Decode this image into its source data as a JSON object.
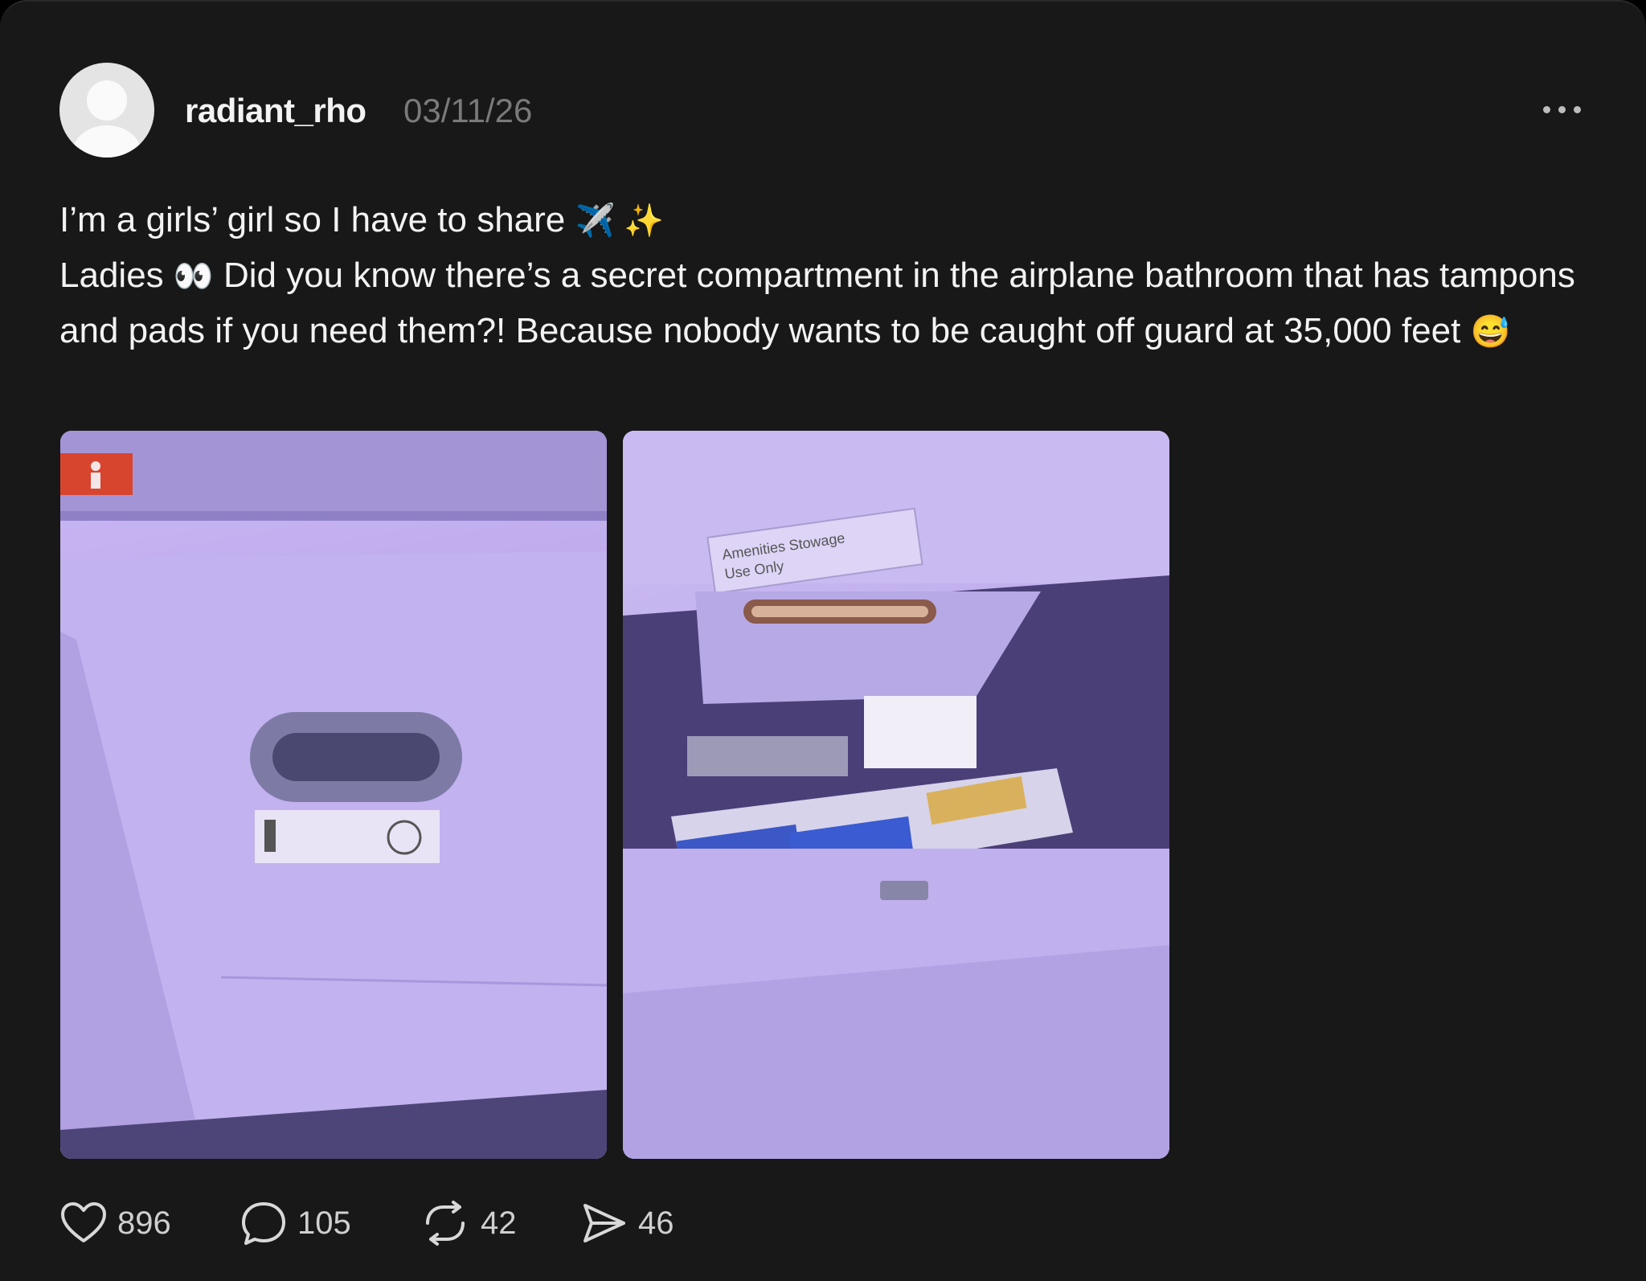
{
  "post": {
    "username": "radiant_rho",
    "date": "03/11/26",
    "line1": "I’m a girls’ girl so I have to share",
    "line1_emoji": "✈️ ✨",
    "ladies": "Ladies",
    "eyes_emoji": "👀",
    "body": "Did you know there’s a secret compartment in the airplane bathroom that has tampons and pads if you need them?! Because nobody wants to be caught off guard at 35,000 feet",
    "end_emoji": "😅",
    "photo1_sticker": "",
    "photo2_label_line1": "Amenities Stowage",
    "photo2_label_line2": "Use Only"
  },
  "actions": {
    "likes": "896",
    "comments": "105",
    "reposts": "42",
    "shares": "46"
  },
  "icons": {
    "like": "heart-icon",
    "comment": "comment-bubble-icon",
    "repost": "repost-icon",
    "share": "send-icon",
    "more": "more-options-icon"
  },
  "colors": {
    "background": "#181818",
    "text": "#f3f3f3",
    "muted": "#7a7a7a"
  }
}
